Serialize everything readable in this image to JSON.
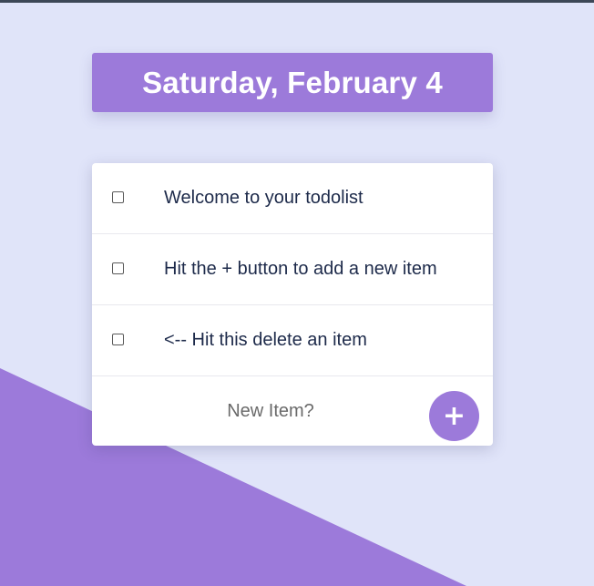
{
  "header": {
    "date_title": "Saturday, February 4"
  },
  "todos": [
    {
      "text": "Welcome to your todolist",
      "checked": false
    },
    {
      "text": "Hit the + button to add a new item",
      "checked": false
    },
    {
      "text": "<-- Hit this delete an item",
      "checked": false
    }
  ],
  "new_item": {
    "placeholder": "New Item?",
    "value": "",
    "add_button_label": "+"
  },
  "colors": {
    "background": "#e0e4f9",
    "accent": "#9c7ada",
    "card": "#ffffff",
    "text": "#1d2a4a"
  }
}
